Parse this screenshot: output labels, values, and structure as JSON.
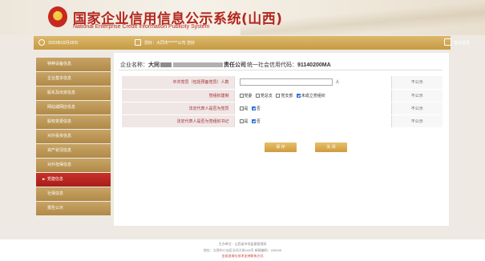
{
  "header": {
    "title_cn": "国家企业信用信息公示系统(山西)",
    "title_en": "National Enterprise Credit Information Publicity System"
  },
  "infobar": {
    "date": "2023年03月28日",
    "welcome": "您好：大同市******公司 您好",
    "logout": "退出登录"
  },
  "sidebar": {
    "items": [
      {
        "label": "特种设备信息"
      },
      {
        "label": "企业基本信息"
      },
      {
        "label": "股东及出资信息"
      },
      {
        "label": "网站或网店信息"
      },
      {
        "label": "股权变更信息"
      },
      {
        "label": "对外投资信息"
      },
      {
        "label": "资产状况信息"
      },
      {
        "label": "对外担保信息"
      },
      {
        "label": "党建信息",
        "active": true
      },
      {
        "label": "社保信息"
      },
      {
        "label": "报告公示"
      }
    ]
  },
  "main": {
    "company_label": "企业名称：",
    "company_prefix": "大同",
    "company_suffix": "责任公司",
    "credit_label": "统一社会信用代码：",
    "credit_code": "91140200MA",
    "rows": [
      {
        "label": "中共党员（包括预备党员）人数",
        "unit": "人",
        "public": "不公示"
      },
      {
        "label": "党组织建制",
        "options": [
          "党委",
          "党总支",
          "党支部",
          "未成立党组织"
        ],
        "public": "不公示"
      },
      {
        "label": "法定代表人是否为党员",
        "options": [
          "是",
          "否"
        ],
        "public": "不公示"
      },
      {
        "label": "法定代表人是否为党组织书记",
        "options": [
          "是",
          "否"
        ],
        "public": "不公示"
      }
    ],
    "save_label": "保 存",
    "close_label": "关 闭"
  },
  "footer": {
    "line1": "主办单位：山西省市场监督管理局",
    "line2": "地址：太原市小店区长风大街108号 邮政编码：030006",
    "line3": "业务咨询与技术支持联系方式"
  },
  "colors": {
    "brand_red": "#b3261e",
    "gold": "#c79b45",
    "active_red": "#a61e18"
  }
}
